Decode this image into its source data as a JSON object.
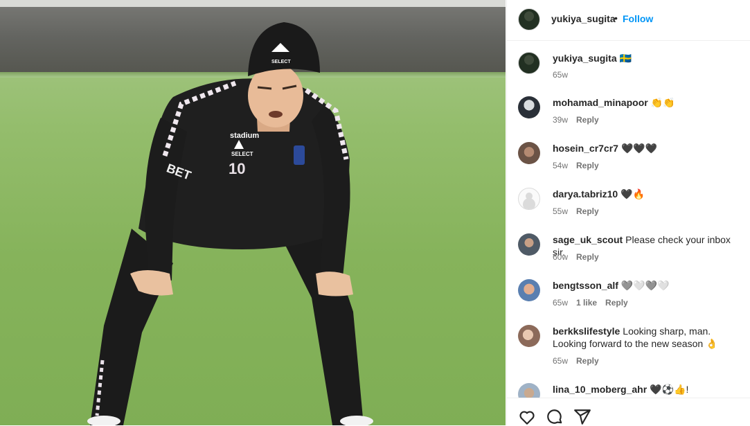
{
  "post": {
    "author": "yukiya_sugita",
    "separator": "•",
    "follow_label": "Follow",
    "photo": {
      "description_icon": "photo",
      "jersey_sponsor": "stadium",
      "jersey_brand": "SELECT",
      "jersey_number": "10",
      "sleeve_text": "BET",
      "cap_brand": "SELECT"
    }
  },
  "comments": [
    {
      "user": "yukiya_sugita",
      "text": "🇸🇪",
      "time": "65w",
      "likes": "",
      "reply": "",
      "avatar": "av-yuki"
    },
    {
      "user": "mohamad_minapoor",
      "text": "👏👏",
      "time": "39w",
      "likes": "",
      "reply": "Reply",
      "avatar": "av-moha"
    },
    {
      "user": "hosein_cr7cr7",
      "text": "🖤🖤🖤",
      "time": "54w",
      "likes": "",
      "reply": "Reply",
      "avatar": "av-hose"
    },
    {
      "user": "darya.tabriz10",
      "text": "🖤🔥",
      "time": "55w",
      "likes": "",
      "reply": "Reply",
      "avatar": "av-dary"
    },
    {
      "user": "sage_uk_scout",
      "text": "Please check your inbox sir.",
      "time": "60w",
      "likes": "",
      "reply": "Reply",
      "avatar": "av-sage"
    },
    {
      "user": "bengtsson_alf",
      "text": "🩶🤍🩶🤍",
      "time": "65w",
      "likes": "1 like",
      "reply": "Reply",
      "avatar": "av-beng"
    },
    {
      "user": "berkkslifestyle",
      "text": "Looking sharp, man. Looking forward to the new season 👌",
      "time": "65w",
      "likes": "",
      "reply": "Reply",
      "avatar": "av-berk"
    },
    {
      "user": "lina_10_moberg_ahr",
      "text": "🖤⚽👍!",
      "time": "",
      "likes": "",
      "reply": "",
      "avatar": "av-lina"
    }
  ],
  "actions": {
    "like_icon": "heart-icon",
    "comment_icon": "comment-icon",
    "share_icon": "share-icon"
  },
  "colors": {
    "accent": "#0095f6",
    "text": "#262626",
    "muted": "#737373",
    "divider": "#efefef"
  }
}
